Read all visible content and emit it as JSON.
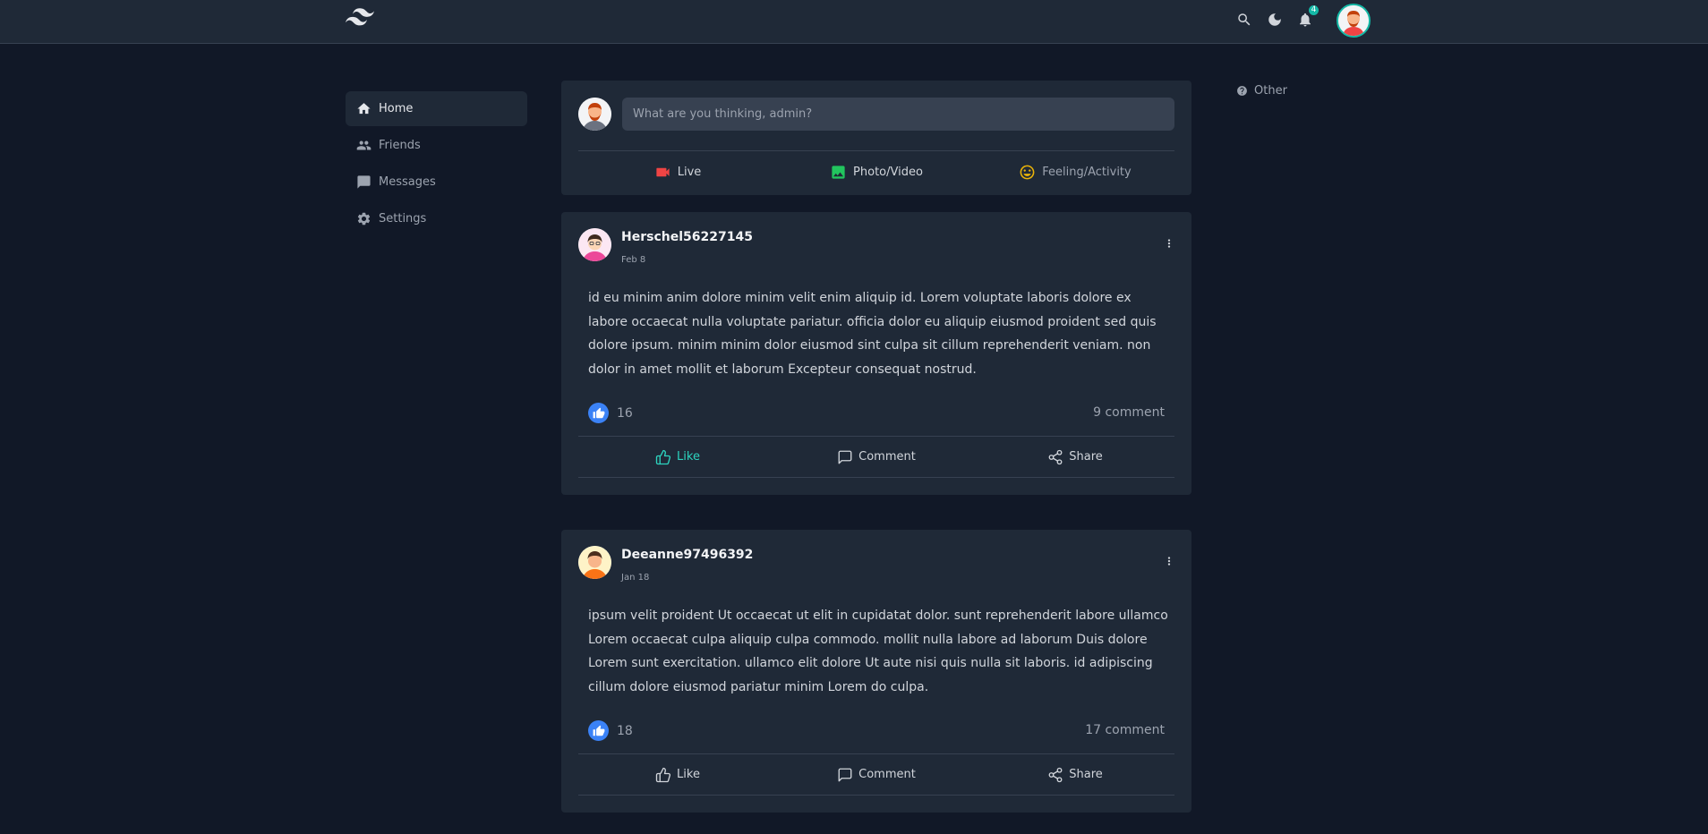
{
  "header": {
    "notifications_count": "4",
    "icons": [
      "tailwind-logo-icon",
      "search-icon",
      "moon-icon",
      "bell-icon",
      "avatar"
    ]
  },
  "sidebar": {
    "items": [
      {
        "label": "Home",
        "icon": "home-icon",
        "active": true
      },
      {
        "label": "Friends",
        "icon": "users-icon",
        "active": false
      },
      {
        "label": "Messages",
        "icon": "message-icon",
        "active": false
      },
      {
        "label": "Settings",
        "icon": "gear-icon",
        "active": false
      }
    ]
  },
  "composer": {
    "placeholder": "What are you thinking, admin?",
    "actions": [
      {
        "label": "Live",
        "icon": "video-icon",
        "color": "#ef4444"
      },
      {
        "label": "Photo/Video",
        "icon": "image-icon",
        "color": "#22c55e"
      },
      {
        "label": "Feeling/Activity",
        "icon": "smile-icon",
        "color": "#eab308"
      }
    ]
  },
  "posts": [
    {
      "author": "Herschel56227145",
      "date": "Feb 8",
      "body": "id eu minim anim dolore minim velit enim aliquip id. Lorem voluptate laboris dolore ex labore occaecat nulla voluptate pariatur. officia dolor eu aliquip eiusmod proident sed quis dolore ipsum. minim minim dolor eiusmod sint culpa sit cillum reprehenderit veniam. non dolor in amet mollit et laborum Excepteur consequat nostrud.",
      "likes": "16",
      "comments": "9 comment",
      "liked": true
    },
    {
      "author": "Deeanne97496392",
      "date": "Jan 18",
      "body": "ipsum velit proident Ut occaecat ut elit in cupidatat dolor. sunt reprehenderit labore ullamco Lorem occaecat culpa aliquip culpa commodo. mollit nulla labore ad laborum Duis dolore Lorem sunt exercitation. ullamco elit dolore Ut aute nisi quis nulla sit laboris. id adipiscing cillum dolore eiusmod pariatur minim Lorem do culpa.",
      "likes": "18",
      "comments": "17 comment",
      "liked": false
    }
  ],
  "post_actions": {
    "like": "Like",
    "comment": "Comment",
    "share": "Share"
  },
  "right_panel": {
    "label": "Other",
    "icon": "help-circle-icon"
  },
  "colors": {
    "accent": "#14b8a6",
    "like_blue": "#3b82f6",
    "bg": "#111827",
    "card": "#1f2937"
  }
}
